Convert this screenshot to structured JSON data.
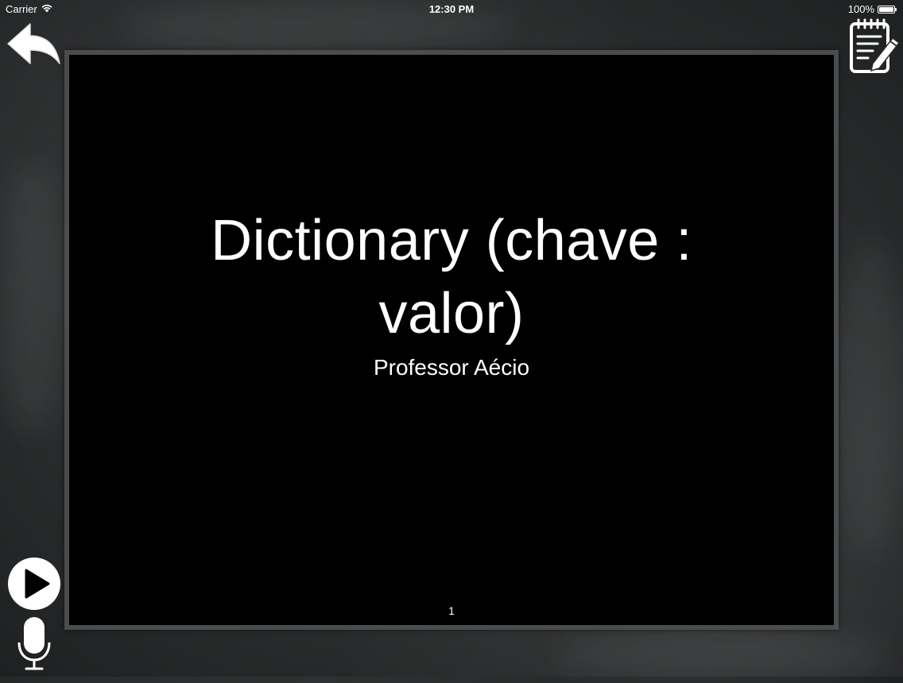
{
  "status_bar": {
    "carrier": "Carrier",
    "time": "12:30 PM",
    "battery": "100%",
    "battery_level": 1.0,
    "icons": [
      "wifi-icon",
      "battery-icon"
    ]
  },
  "slide": {
    "title_line1": "Dictionary (chave :",
    "title_line2": "valor)",
    "subtitle": "Professor Aécio",
    "page_number": "1"
  },
  "controls": {
    "back": "back-arrow-icon",
    "notes": "notepad-pencil-icon",
    "play": "play-icon",
    "mic": "microphone-icon"
  },
  "colors": {
    "slide_background": "#000000",
    "chalkboard": "#2e3031",
    "frame": "#4a4c4d",
    "text": "#ffffff"
  }
}
